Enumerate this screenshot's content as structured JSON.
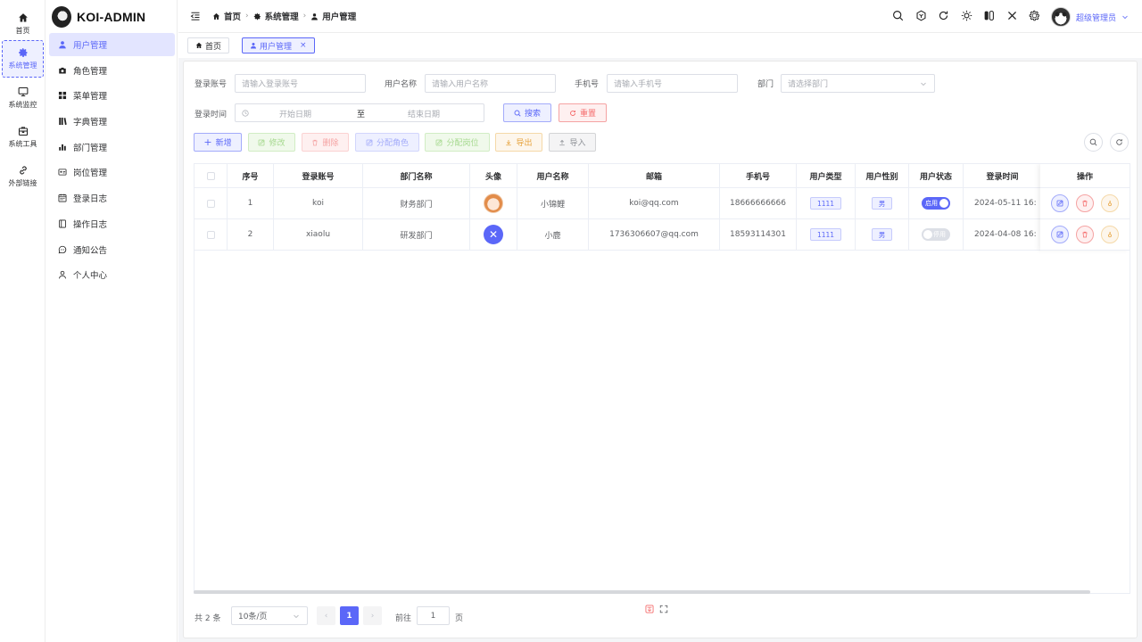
{
  "rail": {
    "items": [
      {
        "label": "首页",
        "icon": "home-icon"
      },
      {
        "label": "系统管理",
        "icon": "gear-icon",
        "active": true
      },
      {
        "label": "系统监控",
        "icon": "monitor-icon"
      },
      {
        "label": "系统工具",
        "icon": "toolbox-icon"
      },
      {
        "label": "外部链接",
        "icon": "link-icon"
      }
    ]
  },
  "brand": {
    "name": "KOI-ADMIN"
  },
  "menu": {
    "items": [
      {
        "label": "用户管理",
        "icon": "user-icon",
        "active": true
      },
      {
        "label": "角色管理",
        "icon": "camera-icon"
      },
      {
        "label": "菜单管理",
        "icon": "grid-icon"
      },
      {
        "label": "字典管理",
        "icon": "book-icon"
      },
      {
        "label": "部门管理",
        "icon": "bar-chart-icon"
      },
      {
        "label": "岗位管理",
        "icon": "id-card-icon"
      },
      {
        "label": "登录日志",
        "icon": "calendar-icon"
      },
      {
        "label": "操作日志",
        "icon": "notebook-icon"
      },
      {
        "label": "通知公告",
        "icon": "message-icon"
      },
      {
        "label": "个人中心",
        "icon": "user-outline-icon"
      }
    ]
  },
  "header": {
    "breadcrumb": [
      "首页",
      "系统管理",
      "用户管理"
    ],
    "tools": [
      "search-icon",
      "cube-icon",
      "refresh-icon",
      "sun-icon",
      "switch-icon",
      "close-icon",
      "settings-icon"
    ],
    "user_name": "超级管理员"
  },
  "tabs": [
    {
      "label": "首页",
      "active": false
    },
    {
      "label": "用户管理",
      "active": true,
      "close": "×"
    }
  ],
  "filters": {
    "login_account": {
      "label": "登录账号",
      "placeholder": "请输入登录账号"
    },
    "user_name": {
      "label": "用户名称",
      "placeholder": "请输入用户名称"
    },
    "phone": {
      "label": "手机号",
      "placeholder": "请输入手机号"
    },
    "dept": {
      "label": "部门",
      "placeholder": "请选择部门"
    },
    "login_time": {
      "label": "登录时间",
      "start": "开始日期",
      "to": "至",
      "end": "结束日期"
    },
    "search_btn": "搜索",
    "reset_btn": "重置"
  },
  "toolbar": {
    "add": "新增",
    "edit": "修改",
    "delete": "删除",
    "assign_role": "分配角色",
    "assign_post": "分配岗位",
    "export": "导出",
    "import": "导入"
  },
  "table": {
    "columns": [
      "序号",
      "登录账号",
      "部门名称",
      "头像",
      "用户名称",
      "邮箱",
      "手机号",
      "用户类型",
      "用户性别",
      "用户状态",
      "登录时间",
      "操作"
    ],
    "rows": [
      {
        "index": "1",
        "account": "koi",
        "dept": "财务部门",
        "avatar": "koi-avatar",
        "name": "小锦鲤",
        "email": "koi@qq.com",
        "phone": "18666666666",
        "type": "1111",
        "gender": "男",
        "status": "启用",
        "status_on": true,
        "time": "2024-05-11 16:"
      },
      {
        "index": "2",
        "account": "xiaolu",
        "dept": "研发部门",
        "avatar": "x-avatar",
        "avatar_text": "✕",
        "name": "小鹿",
        "email": "1736306607@qq.com",
        "phone": "18593114301",
        "type": "1111",
        "gender": "男",
        "status": "停用",
        "status_on": false,
        "time": "2024-04-08 16:"
      }
    ]
  },
  "pagination": {
    "total": "共 2 条",
    "page_size": "10条/页",
    "prev": "‹",
    "current": "1",
    "next": "›",
    "goto_prefix": "前往",
    "goto_value": "1",
    "goto_suffix": "页"
  }
}
